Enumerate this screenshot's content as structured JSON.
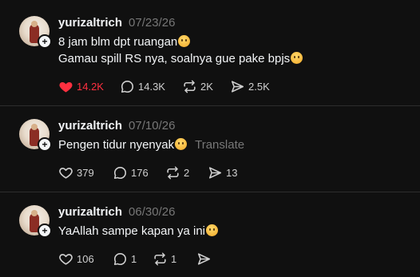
{
  "posts": [
    {
      "username": "yurizaltrich",
      "date": "07/23/26",
      "lines": [
        "8 jam blm dpt ruangan",
        "Gamau spill RS nya, soalnya gue pake bpjs"
      ],
      "translate": "",
      "liked": true,
      "likes": "14.2K",
      "comments": "14.3K",
      "reposts": "2K",
      "shares": "2.5K"
    },
    {
      "username": "yurizaltrich",
      "date": "07/10/26",
      "lines": [
        "Pengen tidur nyenyak"
      ],
      "translate": "Translate",
      "liked": false,
      "likes": "379",
      "comments": "176",
      "reposts": "2",
      "shares": "13"
    },
    {
      "username": "yurizaltrich",
      "date": "06/30/26",
      "lines": [
        "YaAllah sampe kapan ya ini"
      ],
      "translate": "",
      "liked": false,
      "likes": "106",
      "comments": "1",
      "reposts": "1",
      "shares": ""
    }
  ],
  "icons": {
    "like": "heart-icon",
    "comment": "comment-icon",
    "repost": "repost-icon",
    "share": "share-icon",
    "follow": "plus-icon"
  },
  "colors": {
    "background": "#101010",
    "liked": "#ff3040",
    "muted": "#777777",
    "text": "#f3f5f7"
  }
}
